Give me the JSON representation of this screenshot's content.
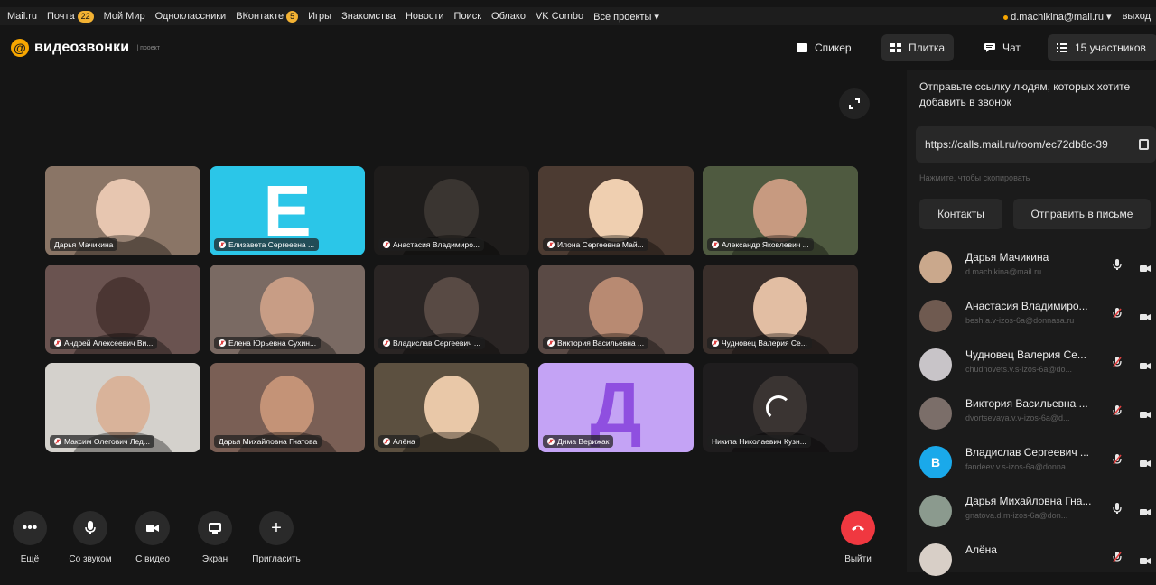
{
  "portal_nav": {
    "items": [
      {
        "label": "Mail.ru"
      },
      {
        "label": "Почта",
        "badge": "22"
      },
      {
        "label": "Мой Мир"
      },
      {
        "label": "Одноклассники"
      },
      {
        "label": "ВКонтакте",
        "badge": "5"
      },
      {
        "label": "Игры"
      },
      {
        "label": "Знакомства"
      },
      {
        "label": "Новости"
      },
      {
        "label": "Поиск"
      },
      {
        "label": "Облако"
      },
      {
        "label": "VK Combo"
      },
      {
        "label": "Все проекты ▾"
      }
    ],
    "user_email": "d.machikina@mail.ru ▾",
    "logout": "выход"
  },
  "header": {
    "logo_mark": "@",
    "logo_text": "видеозвонки",
    "logo_sub": "| проект",
    "speaker_label": "Спикер",
    "grid_label": "Плитка",
    "chat_label": "Чат",
    "participants_label": "15 участников"
  },
  "grid": {
    "tiles": [
      {
        "name": "Дарья Мачикина",
        "muted": false,
        "bg": "#8a7566",
        "face": "#e7c6b0"
      },
      {
        "name": "Елизавета Сергеевна ...",
        "muted": true,
        "bg": "#2bc6e8",
        "letter": "Е"
      },
      {
        "name": "Анастасия Владимиро...",
        "muted": true,
        "bg": "#1e1c1b",
        "face": "#3a3531"
      },
      {
        "name": "Илона Сергеевна Май...",
        "muted": true,
        "bg": "#4c3b32",
        "face": "#efcfb0"
      },
      {
        "name": "Александр Яковлевич ...",
        "muted": true,
        "bg": "#4f5a40",
        "face": "#c79a80"
      },
      {
        "name": "Андрей Алексеевич Ви...",
        "muted": true,
        "bg": "#6a5350",
        "face": "#4b3633"
      },
      {
        "name": "Елена Юрьевна Сухин...",
        "muted": true,
        "bg": "#7a6a63",
        "face": "#c89d85"
      },
      {
        "name": "Владислав Сергеевич ...",
        "muted": true,
        "bg": "#2a2524",
        "face": "#584a44"
      },
      {
        "name": "Виктория Васильевна ...",
        "muted": true,
        "bg": "#5a4a45",
        "face": "#b88a72"
      },
      {
        "name": "Чудновец Валерия Се...",
        "muted": true,
        "bg": "#3a2f2b",
        "face": "#e2bea3"
      },
      {
        "name": "Максим Олегович Лед...",
        "muted": true,
        "bg": "#d4d1cc",
        "face": "#d9b39a"
      },
      {
        "name": "Дарья Михайловна Гнатова",
        "muted": false,
        "bg": "#7a5f55",
        "face": "#c49377"
      },
      {
        "name": "Алёна",
        "muted": true,
        "bg": "#5c5040",
        "face": "#e9c8a8"
      },
      {
        "name": "Дима Верижак",
        "muted": true,
        "bg": "#c4a3f5",
        "letter": "Д"
      },
      {
        "name": "Никита Николаевич Кузн...",
        "muted": false,
        "bg": "#1f1d1e",
        "face": "#3a3432",
        "spinner": true
      }
    ]
  },
  "controls": {
    "more_label": "Ещё",
    "sound_label": "Со звуком",
    "video_label": "С видео",
    "screen_label": "Экран",
    "invite_label": "Пригласить",
    "leave_label": "Выйти"
  },
  "panel": {
    "invite_text": "Отправьте ссылку людям, которых хотите добавить в звонок",
    "link": "https://calls.mail.ru/room/ec72db8c-39",
    "copy_hint": "Нажмите, чтобы скопировать",
    "contacts_label": "Контакты",
    "send_mail_label": "Отправить в письме",
    "participants": [
      {
        "name": "Дарья Мачикина",
        "email": "d.machikina@mail.ru",
        "muted": false,
        "avatar_color": "#caa88c"
      },
      {
        "name": "Анастасия Владимиро...",
        "email": "besh.a.v-izos-6a@donnasa.ru",
        "muted": true,
        "avatar_color": "#6f5a50"
      },
      {
        "name": "Чудновец Валерия Се...",
        "email": "chudnovets.v.s-izos-6a@do...",
        "muted": true,
        "avatar_color": "#c8c4c8"
      },
      {
        "name": "Виктория Васильевна ...",
        "email": "dvortsevaya.v.v-izos-6a@d...",
        "muted": true,
        "avatar_color": "#7b6e69"
      },
      {
        "name": "Владислав Сергеевич ...",
        "email": "fandeev.v.s-izos-6a@donna...",
        "muted": true,
        "avatar_color": "#1aa9ea",
        "letter": "В"
      },
      {
        "name": "Дарья Михайловна Гна...",
        "email": "gnatova.d.m-izos-6a@don...",
        "muted": false,
        "avatar_color": "#8b9a8e"
      },
      {
        "name": "Алёна",
        "email": "",
        "muted": true,
        "avatar_color": "#d8cfc7"
      }
    ]
  }
}
